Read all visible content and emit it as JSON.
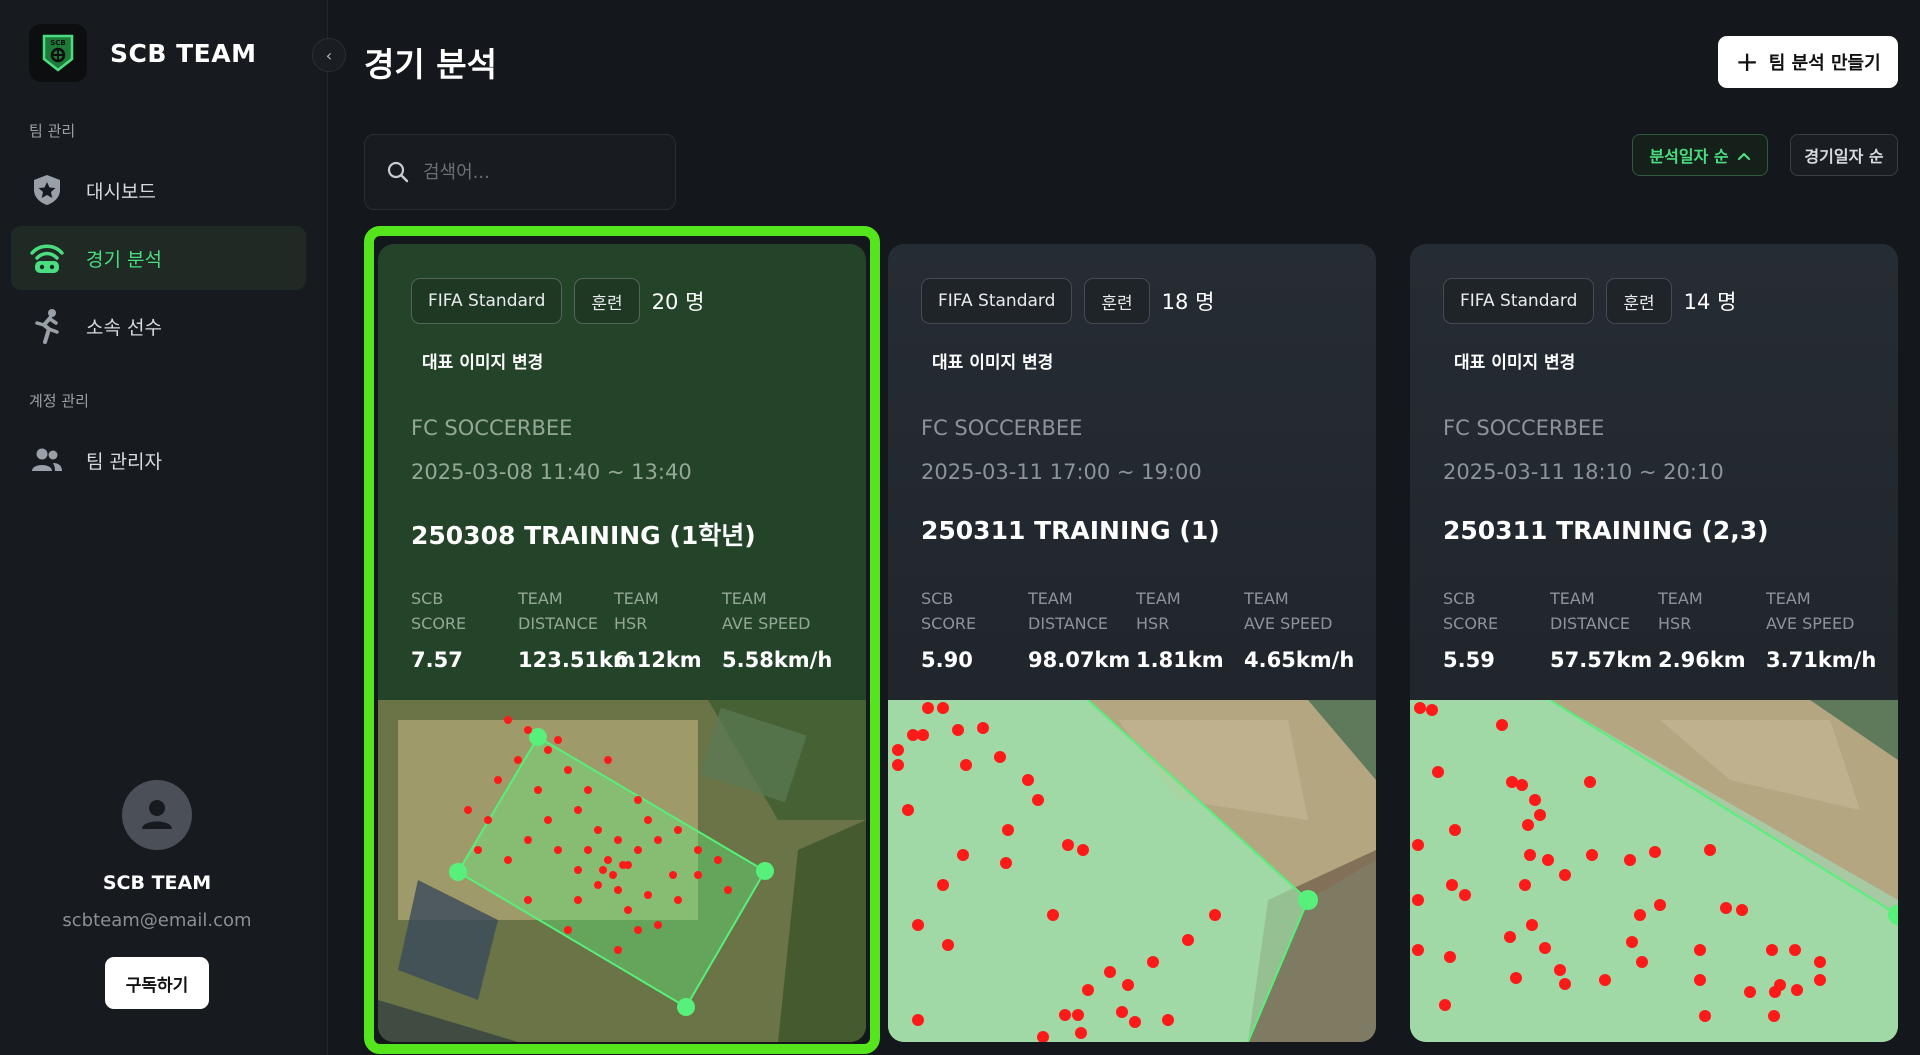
{
  "app": {
    "name": "SCB TEAM",
    "logo_text": "SCB",
    "collapse_icon": "chevron-left-icon"
  },
  "sidebar": {
    "sections": [
      {
        "label": "팀 관리"
      },
      {
        "label": "계정 관리"
      }
    ],
    "items": [
      {
        "label": "대시보드",
        "icon": "shield-star-icon",
        "active": false
      },
      {
        "label": "경기 분석",
        "icon": "signal-analysis-icon",
        "active": true
      },
      {
        "label": "소속 선수",
        "icon": "player-kick-icon",
        "active": false
      },
      {
        "label": "팀 관리자",
        "icon": "users-icon",
        "active": false
      }
    ],
    "profile": {
      "name": "SCB TEAM",
      "email": "scbteam@email.com",
      "subscribe_label": "구독하기"
    }
  },
  "header": {
    "title": "경기 분석",
    "create_label": "팀 분석 만들기"
  },
  "search": {
    "placeholder": "검색어..."
  },
  "sort": {
    "by_analysis": "분석일자 순",
    "by_match": "경기일자 순"
  },
  "colors": {
    "accent": "#4ade80",
    "selection": "#55e51c",
    "dot": "#ff1a1a"
  },
  "cards": [
    {
      "standard": "FIFA Standard",
      "type": "훈련",
      "count": "20 명",
      "change_image": "대표 이미지 변경",
      "team": "FC SOCCERBEE",
      "time": "2025-03-08 11:40 ~ 13:40",
      "title": "250308 TRAINING (1학년)",
      "stats": [
        {
          "label1": "SCB",
          "label2": "SCORE",
          "value": "7.57"
        },
        {
          "label1": "TEAM",
          "label2": "DISTANCE",
          "value": "123.51km"
        },
        {
          "label1": "TEAM",
          "label2": "HSR",
          "value": "6.12km"
        },
        {
          "label1": "TEAM",
          "label2": "AVE SPEED",
          "value": "5.58km/h"
        }
      ],
      "selected": true
    },
    {
      "standard": "FIFA Standard",
      "type": "훈련",
      "count": "18 명",
      "change_image": "대표 이미지 변경",
      "team": "FC SOCCERBEE",
      "time": "2025-03-11 17:00 ~ 19:00",
      "title": "250311 TRAINING (1)",
      "stats": [
        {
          "label1": "SCB",
          "label2": "SCORE",
          "value": "5.90"
        },
        {
          "label1": "TEAM",
          "label2": "DISTANCE",
          "value": "98.07km"
        },
        {
          "label1": "TEAM",
          "label2": "HSR",
          "value": "1.81km"
        },
        {
          "label1": "TEAM",
          "label2": "AVE SPEED",
          "value": "4.65km/h"
        }
      ],
      "selected": false
    },
    {
      "standard": "FIFA Standard",
      "type": "훈련",
      "count": "14 명",
      "change_image": "대표 이미지 변경",
      "team": "FC SOCCERBEE",
      "time": "2025-03-11 18:10 ~ 20:10",
      "title": "250311 TRAINING (2,3)",
      "stats": [
        {
          "label1": "SCB",
          "label2": "SCORE",
          "value": "5.59"
        },
        {
          "label1": "TEAM",
          "label2": "DISTANCE",
          "value": "57.57km"
        },
        {
          "label1": "TEAM",
          "label2": "HSR",
          "value": "2.96km"
        },
        {
          "label1": "TEAM",
          "label2": "AVE SPEED",
          "value": "3.71km/h"
        }
      ],
      "selected": false
    }
  ]
}
